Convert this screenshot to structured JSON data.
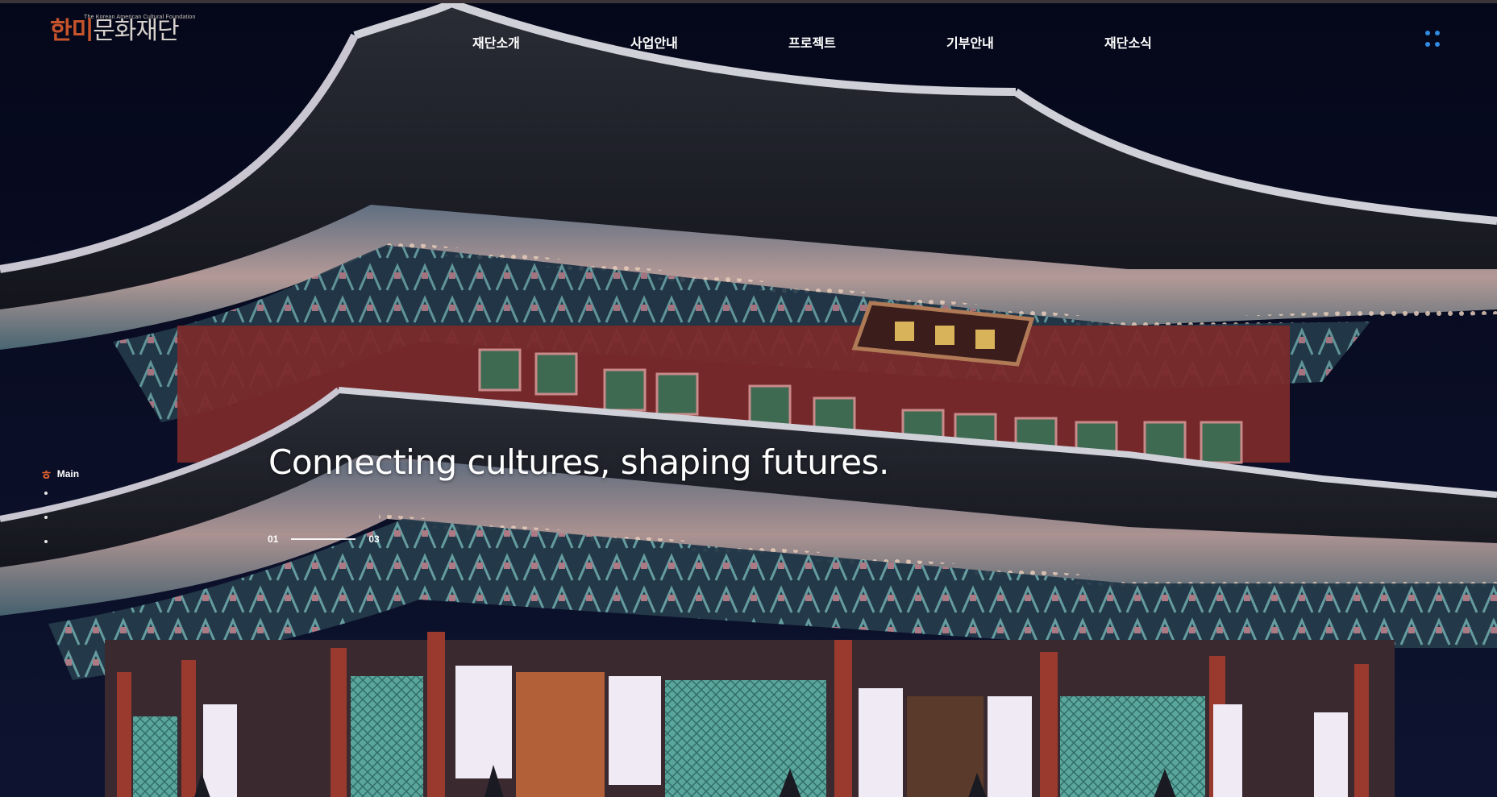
{
  "logo": {
    "subtitle": "The Korean American Cultural Foundation",
    "highlight": "한미",
    "rest": "문화재단"
  },
  "nav": {
    "items": [
      {
        "label": "재단소개"
      },
      {
        "label": "사업안내"
      },
      {
        "label": "프로젝트"
      },
      {
        "label": "기부안내"
      },
      {
        "label": "재단소식"
      }
    ]
  },
  "menu": {
    "icon": "grid-menu-icon"
  },
  "side_nav": {
    "current_glyph": "ㅎ",
    "current_label": "Main",
    "dot_count": 3
  },
  "hero": {
    "headline": "Connecting cultures, shaping futures.",
    "pager": {
      "current": "01",
      "total": "03"
    }
  },
  "colors": {
    "accent": "#c5532b",
    "menu_blue": "#2f8ce0",
    "roof_dark": "#1d1f28",
    "pillar_red": "#8a2a24",
    "panel_teal": "#3f8f8a"
  }
}
